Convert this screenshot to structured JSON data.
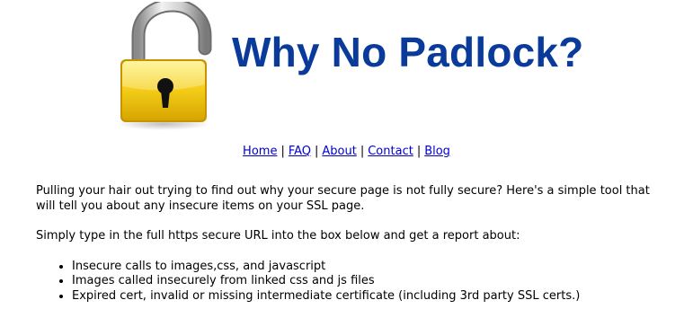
{
  "header": {
    "title": "Why No Padlock?"
  },
  "nav": {
    "items": [
      {
        "label": "Home"
      },
      {
        "label": "FAQ"
      },
      {
        "label": "About"
      },
      {
        "label": "Contact"
      },
      {
        "label": "Blog"
      }
    ],
    "separator": "|"
  },
  "intro": {
    "paragraph1": "Pulling your hair out trying to find out why your secure page is not fully secure? Here's a simple tool that will tell you about any insecure items on your SSL page.",
    "paragraph2": "Simply type in the full https secure URL into the box below and get a report about:"
  },
  "features": [
    "Insecure calls to images,css, and javascript",
    "Images called insecurely from linked css and js files",
    "Expired cert, invalid or missing intermediate certificate (including 3rd party SSL certs.)"
  ],
  "colors": {
    "title": "#0a3a9a",
    "link": "#0000cc",
    "padlock_body": "#f2c40f"
  }
}
